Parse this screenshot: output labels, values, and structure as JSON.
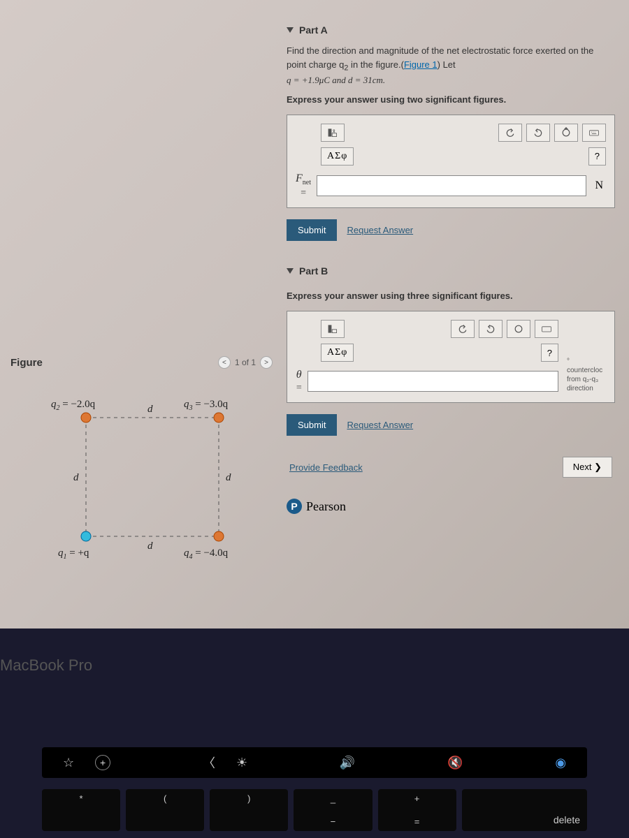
{
  "partA": {
    "header": "Part A",
    "prompt_text_1": "Find the direction and magnitude of the net electrostatic force exerted on the point charge q",
    "prompt_sub": "2",
    "prompt_text_2": " in the figure.(",
    "figure_link": "Figure 1",
    "prompt_text_3": ") Let",
    "equation": "q = +1.9μC and d = 31cm.",
    "instruction": "Express your answer using two significant figures.",
    "greek": "ΑΣφ",
    "help": "?",
    "var": "F",
    "var_sub": "net",
    "unit": "N",
    "submit": "Submit",
    "request": "Request Answer"
  },
  "partB": {
    "header": "Part B",
    "instruction": "Express your answer using three significant figures.",
    "greek": "ΑΣφ",
    "help": "?",
    "var": "θ",
    "unit_deg": "°",
    "unit_note1": "countercloc",
    "unit_note2": "from q₂-q₃",
    "unit_note3": "direction",
    "submit": "Submit",
    "request": "Request Answer"
  },
  "footer": {
    "feedback": "Provide Feedback",
    "next": "Next ❯",
    "brand": "Pearson",
    "brand_p": "P"
  },
  "figure": {
    "title": "Figure",
    "page": "1 of 1",
    "q2": "q₂ = −2.0q",
    "q3": "q₃ = −3.0q",
    "q1": "q₁ = +q",
    "q4": "q₄ = −4.0q",
    "d": "d"
  },
  "macbook": "MacBook Pro",
  "touchbar": {
    "star": "☆",
    "plus": "+",
    "back": "〈",
    "bright": "☀",
    "vol": "🔊",
    "mute": "🔇",
    "siri": "◉"
  },
  "keys": {
    "asterisk": "*",
    "paren_open": "(",
    "paren_close": ")",
    "underscore": "_",
    "minus": "−",
    "plus": "+",
    "equals": "=",
    "delete": "delete"
  }
}
